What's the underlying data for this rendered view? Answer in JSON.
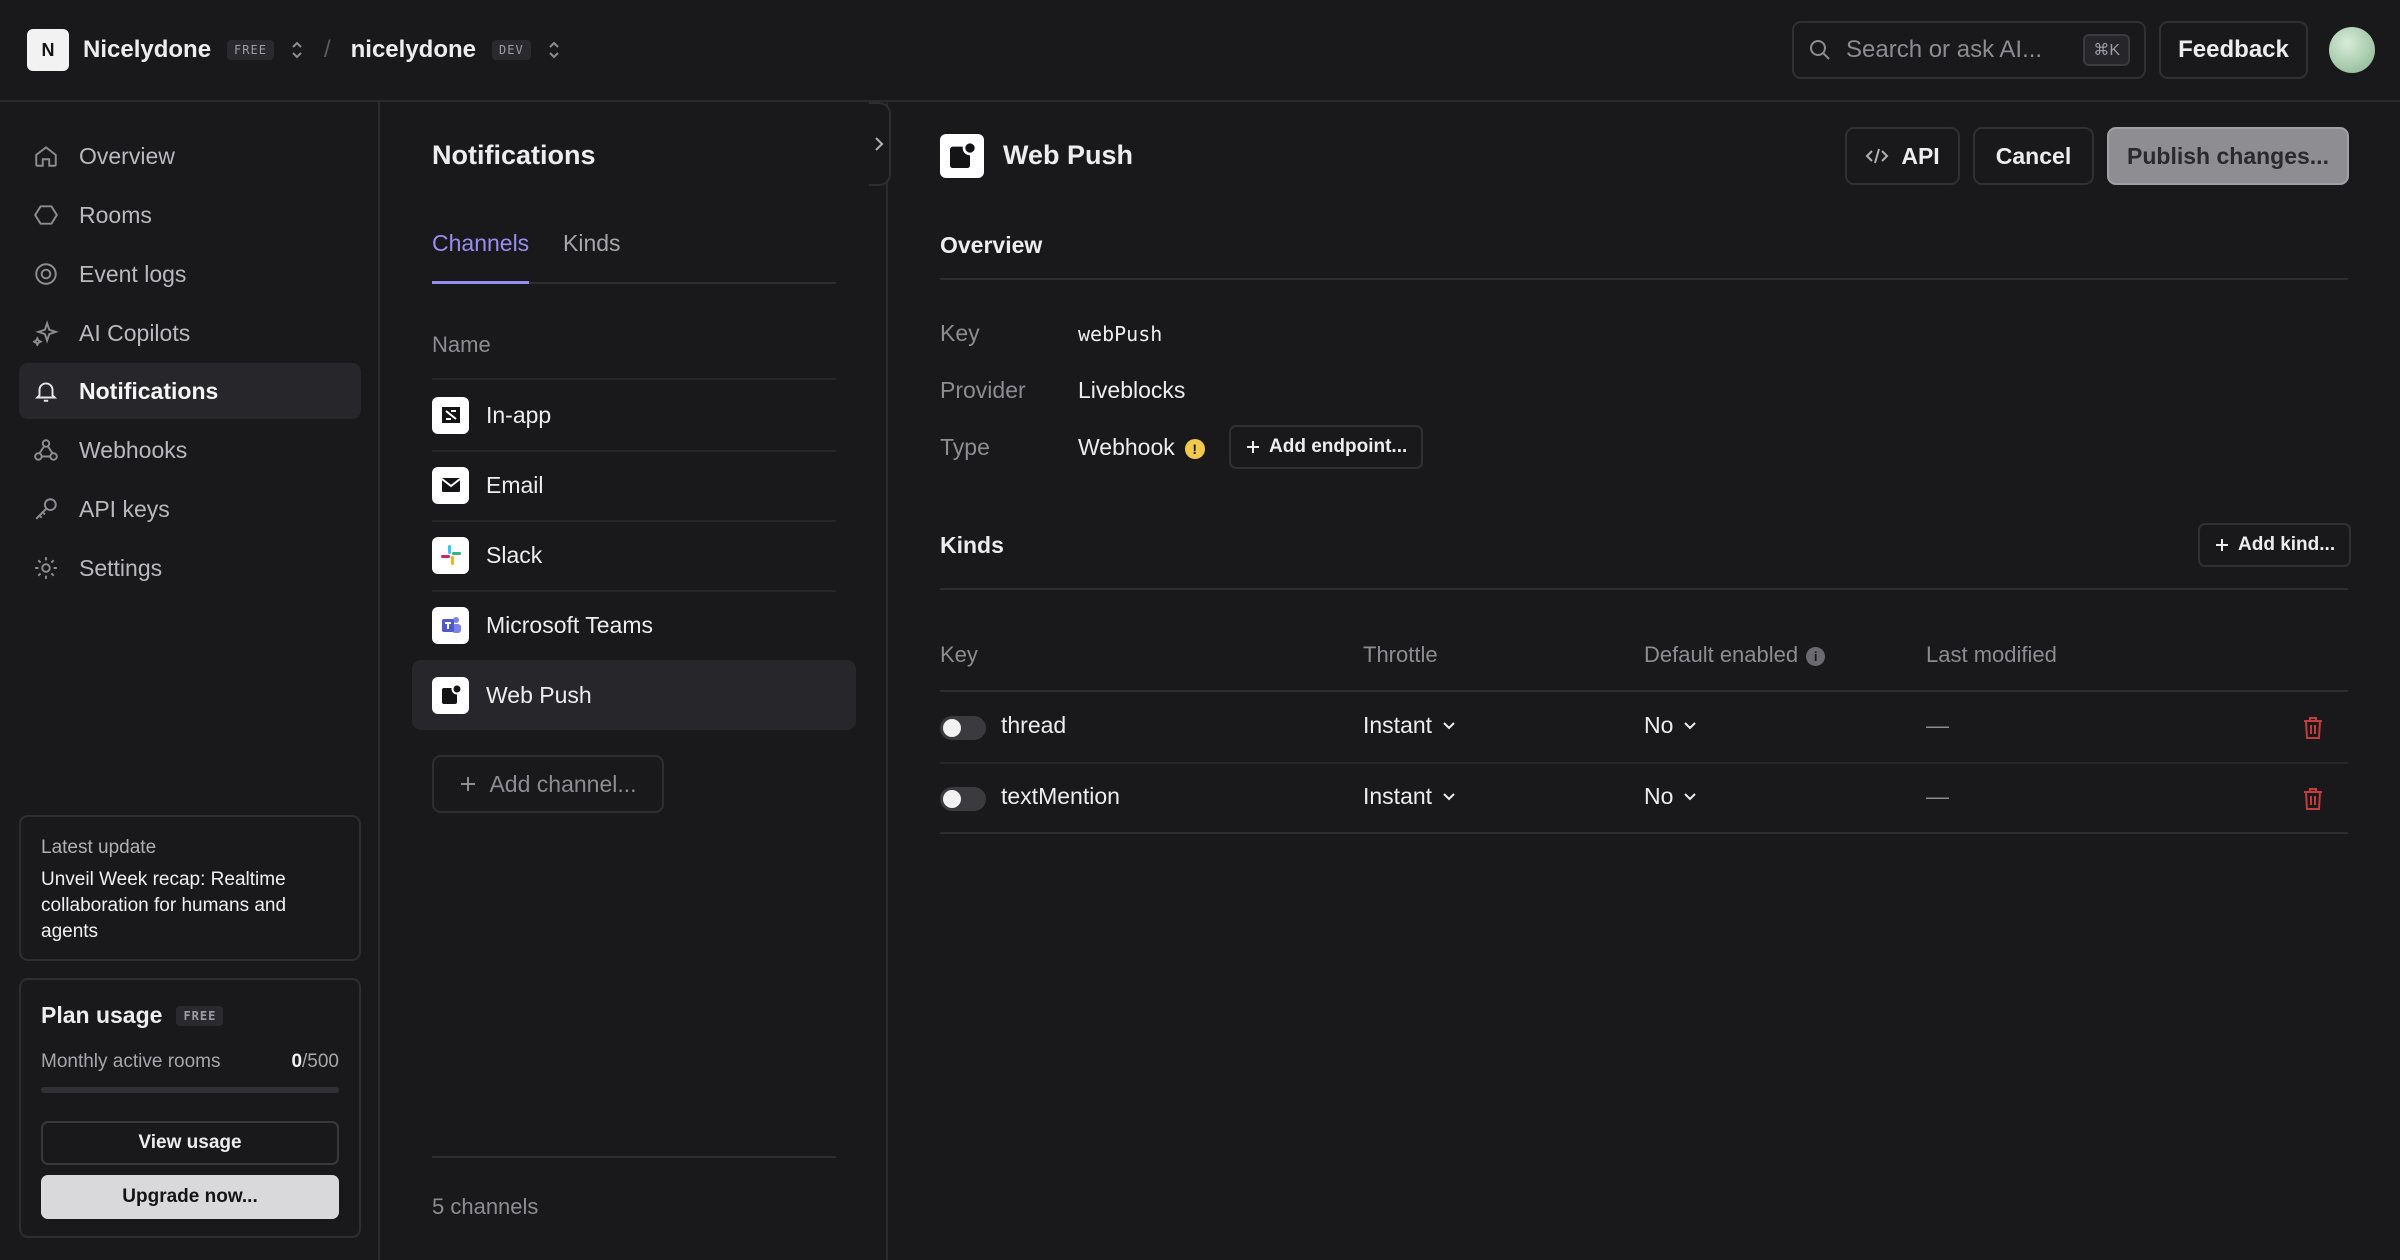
{
  "header": {
    "logo_letter": "N",
    "org_name": "Nicelydone",
    "org_plan": "FREE",
    "project_name": "nicelydone",
    "project_env": "DEV",
    "search_placeholder": "Search or ask AI...",
    "search_shortcut": "⌘K",
    "feedback_label": "Feedback"
  },
  "sidebar": {
    "items": [
      {
        "label": "Overview",
        "icon": "home-icon"
      },
      {
        "label": "Rooms",
        "icon": "hexagon-icon"
      },
      {
        "label": "Event logs",
        "icon": "target-icon"
      },
      {
        "label": "AI Copilots",
        "icon": "sparkle-icon"
      },
      {
        "label": "Notifications",
        "icon": "bell-icon",
        "active": true
      },
      {
        "label": "Webhooks",
        "icon": "webhook-icon"
      },
      {
        "label": "API keys",
        "icon": "key-icon"
      },
      {
        "label": "Settings",
        "icon": "gear-icon"
      }
    ],
    "latest_update": {
      "label": "Latest update",
      "text": "Unveil Week recap: Realtime collaboration for humans and agents"
    },
    "plan": {
      "title": "Plan usage",
      "badge": "FREE",
      "metric_label": "Monthly active rooms",
      "used": "0",
      "limit": "/500",
      "usage_fraction": 0,
      "view_usage_label": "View usage",
      "upgrade_label": "Upgrade now..."
    }
  },
  "channels_panel": {
    "title": "Notifications",
    "tabs": [
      "Channels",
      "Kinds"
    ],
    "active_tab": "Channels",
    "column_header": "Name",
    "channels": [
      {
        "name": "In-app",
        "icon": "inapp-icon"
      },
      {
        "name": "Email",
        "icon": "envelope-icon"
      },
      {
        "name": "Slack",
        "icon": "slack-icon"
      },
      {
        "name": "Microsoft Teams",
        "icon": "teams-icon"
      },
      {
        "name": "Web Push",
        "icon": "webpush-icon",
        "active": true
      }
    ],
    "add_channel_label": "Add channel...",
    "footer_count": "5 channels"
  },
  "detail": {
    "title": "Web Push",
    "api_label": "API",
    "cancel_label": "Cancel",
    "publish_label": "Publish changes...",
    "overview_heading": "Overview",
    "fields": {
      "key_label": "Key",
      "key_value": "webPush",
      "provider_label": "Provider",
      "provider_value": "Liveblocks",
      "type_label": "Type",
      "type_value": "Webhook",
      "warning_glyph": "!",
      "add_endpoint_label": "Add endpoint..."
    },
    "kinds_heading": "Kinds",
    "add_kind_label": "Add kind...",
    "table": {
      "headers": {
        "key": "Key",
        "throttle": "Throttle",
        "default_enabled": "Default enabled",
        "last_modified": "Last modified"
      },
      "info_glyph": "i",
      "rows": [
        {
          "key": "thread",
          "throttle": "Instant",
          "default_enabled": "No",
          "last_modified": "—"
        },
        {
          "key": "textMention",
          "throttle": "Instant",
          "default_enabled": "No",
          "last_modified": "—"
        }
      ]
    }
  },
  "colors": {
    "background": "#19191b",
    "accent": "#9b8cf2",
    "danger": "#c43c3c",
    "warning": "#f2c94c"
  }
}
